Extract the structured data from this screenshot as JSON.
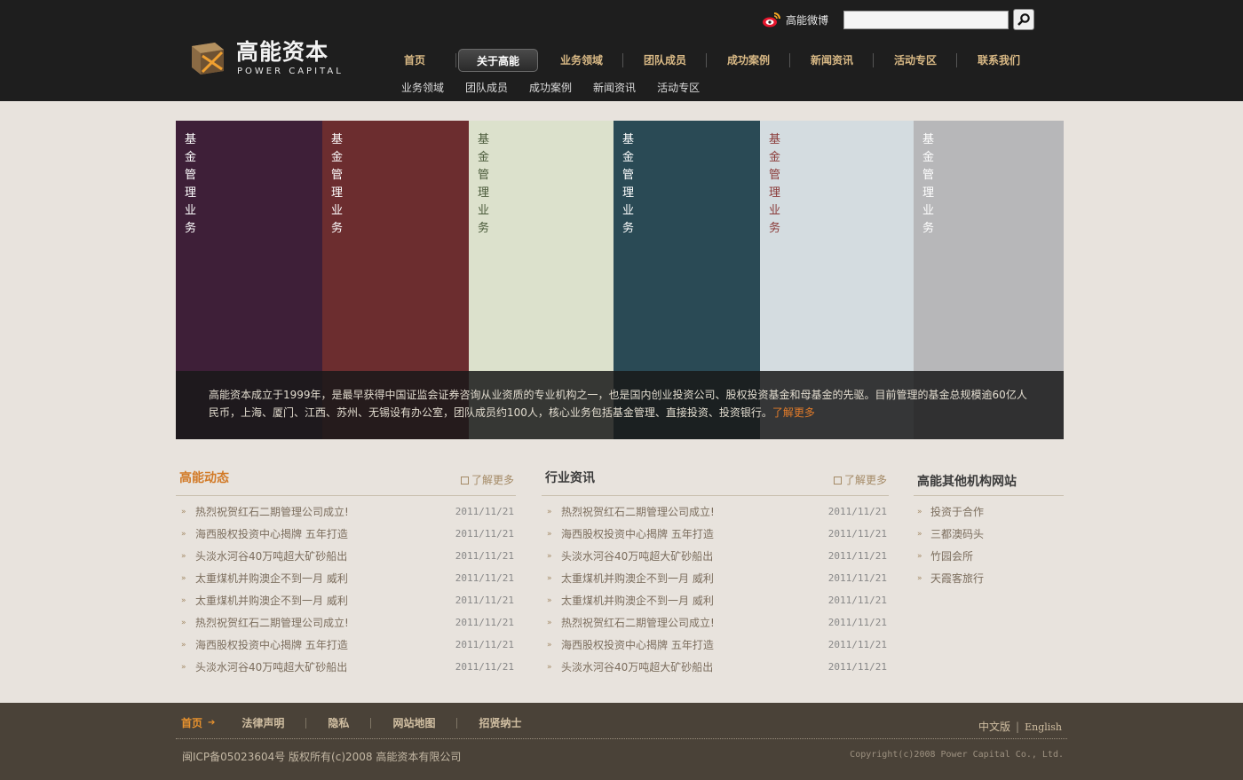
{
  "header": {
    "logo_cn": "高能资本",
    "logo_en": "POWER CAPITAL",
    "weibo_label": "高能微博",
    "search_placeholder": "",
    "nav": [
      {
        "label": "首页",
        "active": false
      },
      {
        "label": "关于高能",
        "active": true
      },
      {
        "label": "业务领域",
        "active": false
      },
      {
        "label": "团队成员",
        "active": false
      },
      {
        "label": "成功案例",
        "active": false
      },
      {
        "label": "新闻资讯",
        "active": false
      },
      {
        "label": "活动专区",
        "active": false
      },
      {
        "label": "联系我们",
        "active": false
      }
    ],
    "subnav": [
      "业务领域",
      "团队成员",
      "成功案例",
      "新闻资讯",
      "活动专区"
    ]
  },
  "banner": {
    "panels": [
      {
        "label": "基金管理业务",
        "bg": "#3e1f38",
        "fg": "#ffffff"
      },
      {
        "label": "基金管理业务",
        "bg": "#6c2d2f",
        "fg": "#ffffff"
      },
      {
        "label": "基金管理业务",
        "bg": "#dce1cc",
        "fg": "#4a5a3a"
      },
      {
        "label": "基金管理业务",
        "bg": "#2a4a55",
        "fg": "#ffffff"
      },
      {
        "label": "基金管理业务",
        "bg": "#d4dce0",
        "fg": "#8a3a38"
      },
      {
        "label": "基金管理业务",
        "bg": "#b7b7b9",
        "fg": "#ffffff"
      }
    ],
    "caption": "高能资本成立于1999年，是最早获得中国证监会证券咨询从业资质的专业机构之一，也是国内创业投资公司、股权投资基金和母基金的先驱。目前管理的基金总规模逾60亿人民币，上海、厦门、江西、苏州、无锡设有办公室，团队成员约100人，核心业务包括基金管理、直接投资、投资银行。",
    "more": "了解更多"
  },
  "news1": {
    "title": "高能动态",
    "title_color": "#d27a27",
    "more": "了解更多",
    "items": [
      {
        "title": "热烈祝贺红石二期管理公司成立!",
        "date": "2011/11/21"
      },
      {
        "title": "海西股权投资中心揭牌 五年打造",
        "date": "2011/11/21"
      },
      {
        "title": "头淡水河谷40万吨超大矿砂船出",
        "date": "2011/11/21"
      },
      {
        "title": "太重煤机并购澳企不到一月 威利",
        "date": "2011/11/21"
      },
      {
        "title": "太重煤机并购澳企不到一月 威利",
        "date": "2011/11/21"
      },
      {
        "title": "热烈祝贺红石二期管理公司成立!",
        "date": "2011/11/21"
      },
      {
        "title": "海西股权投资中心揭牌 五年打造",
        "date": "2011/11/21"
      },
      {
        "title": "头淡水河谷40万吨超大矿砂船出",
        "date": "2011/11/21"
      }
    ]
  },
  "news2": {
    "title": "行业资讯",
    "title_color": "#3b3b3b",
    "more": "了解更多",
    "items": [
      {
        "title": "热烈祝贺红石二期管理公司成立!",
        "date": "2011/11/21"
      },
      {
        "title": "海西股权投资中心揭牌 五年打造",
        "date": "2011/11/21"
      },
      {
        "title": "头淡水河谷40万吨超大矿砂船出",
        "date": "2011/11/21"
      },
      {
        "title": "太重煤机并购澳企不到一月 威利",
        "date": "2011/11/21"
      },
      {
        "title": "太重煤机并购澳企不到一月 威利",
        "date": "2011/11/21"
      },
      {
        "title": "热烈祝贺红石二期管理公司成立!",
        "date": "2011/11/21"
      },
      {
        "title": "海西股权投资中心揭牌 五年打造",
        "date": "2011/11/21"
      },
      {
        "title": "头淡水河谷40万吨超大矿砂船出",
        "date": "2011/11/21"
      }
    ]
  },
  "sites": {
    "title": "高能其他机构网站",
    "items": [
      "投资于合作",
      "三都澳码头",
      "竹园会所",
      "天霞客旅行"
    ]
  },
  "footer": {
    "links": [
      "首页",
      "法律声明",
      "隐私",
      "网站地图",
      "招贤纳士"
    ],
    "lang_cn": "中文版",
    "lang_en": "English",
    "icp": "闽ICP备05023604号 版权所有(c)2008 高能资本有限公司",
    "copyright": "Copyright(c)2008 Power Capital Co., Ltd."
  }
}
